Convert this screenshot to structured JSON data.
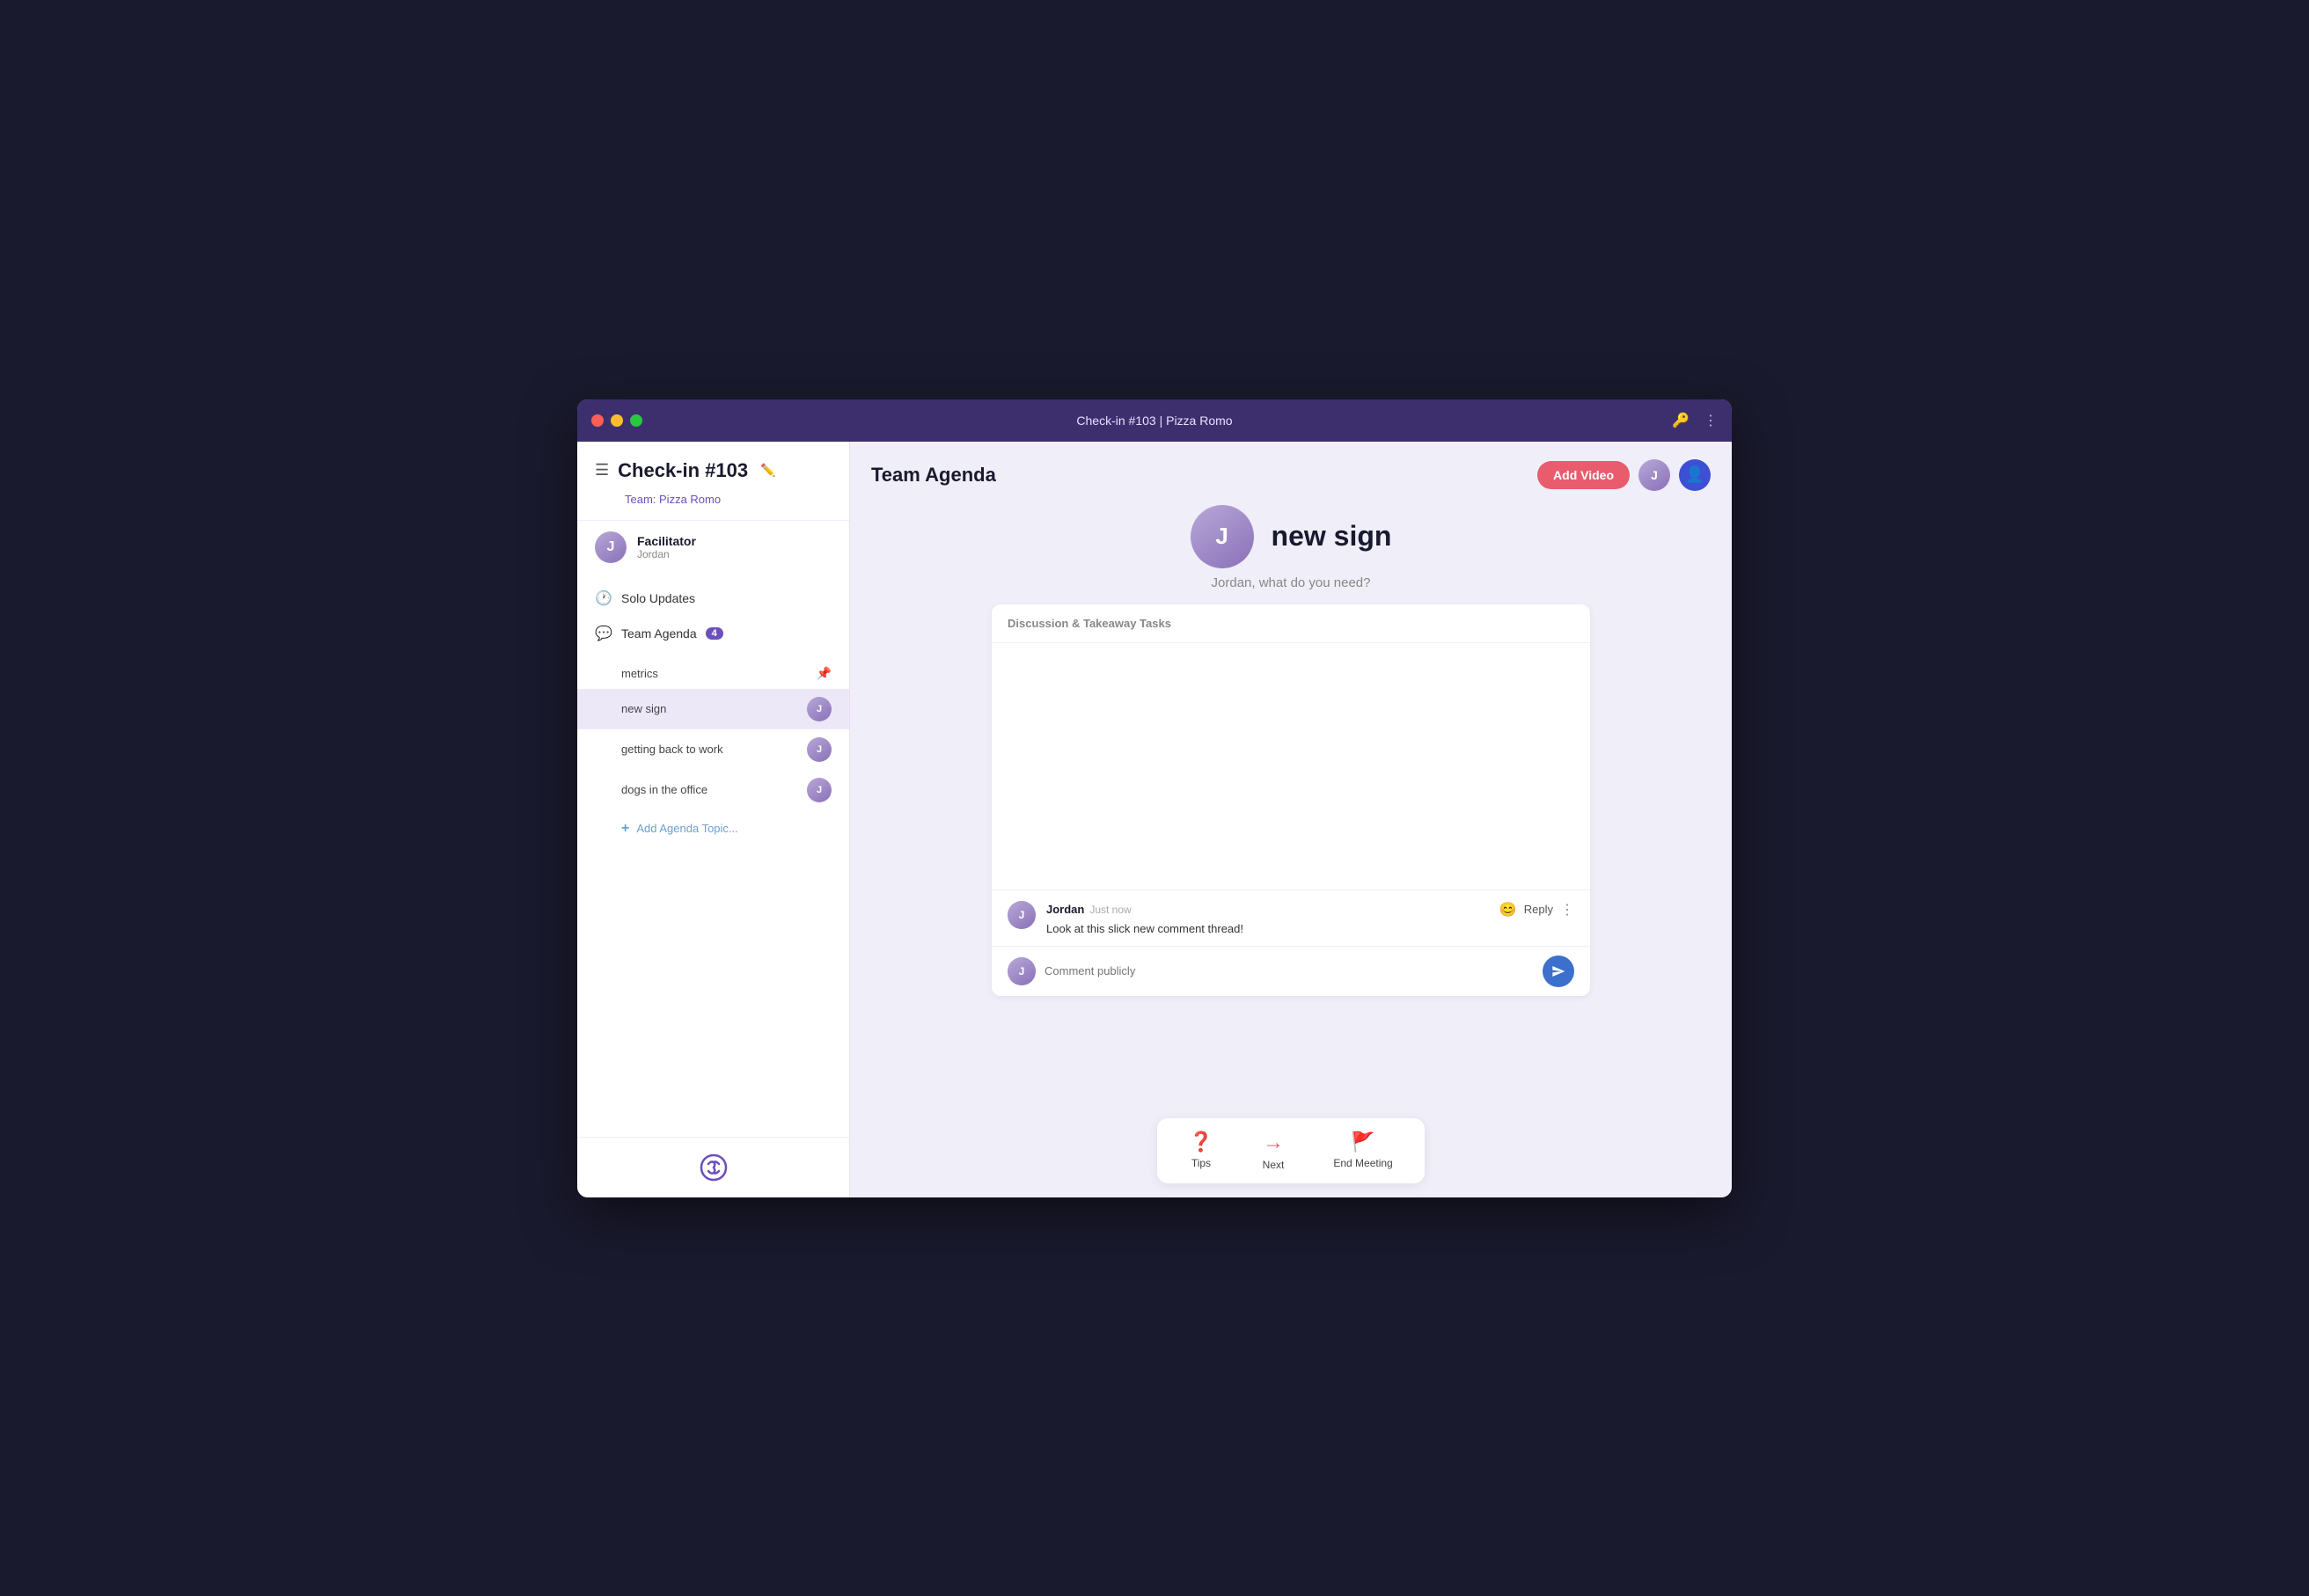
{
  "titlebar": {
    "title": "Check-in #103 | Pizza Romo",
    "key_icon": "🔑",
    "more_icon": "⋮"
  },
  "sidebar": {
    "meeting_title": "Check-in #103",
    "team_name": "Team: Pizza Romo",
    "facilitator": {
      "label": "Facilitator",
      "name": "Jordan"
    },
    "nav_items": [
      {
        "id": "solo-updates",
        "icon": "🕐",
        "label": "Solo Updates"
      },
      {
        "id": "team-agenda",
        "icon": "💬",
        "label": "Team Agenda",
        "badge": "4"
      }
    ],
    "agenda_topics": [
      {
        "id": "metrics",
        "label": "metrics",
        "type": "pinned"
      },
      {
        "id": "new-sign",
        "label": "new sign",
        "type": "avatar",
        "active": true
      },
      {
        "id": "getting-back-to-work",
        "label": "getting back to work",
        "type": "avatar"
      },
      {
        "id": "dogs-in-the-office",
        "label": "dogs in the office",
        "type": "avatar"
      }
    ],
    "add_topic_label": "Add Agenda Topic...",
    "logo_alt": "Romo logo"
  },
  "header": {
    "page_title": "Team Agenda",
    "add_video_label": "Add Video"
  },
  "main": {
    "topic": {
      "title": "new sign",
      "presenter": "Jordan",
      "subtitle": "Jordan, what do you need?"
    },
    "discussion": {
      "header": "Discussion & Takeaway Tasks",
      "comment": {
        "author": "Jordan",
        "time": "Just now",
        "text": "Look at this slick new comment thread!",
        "reply_label": "Reply"
      },
      "input_placeholder": "Comment publicly"
    }
  },
  "bottom_bar": {
    "tips_label": "Tips",
    "next_label": "Next",
    "end_meeting_label": "End Meeting"
  }
}
